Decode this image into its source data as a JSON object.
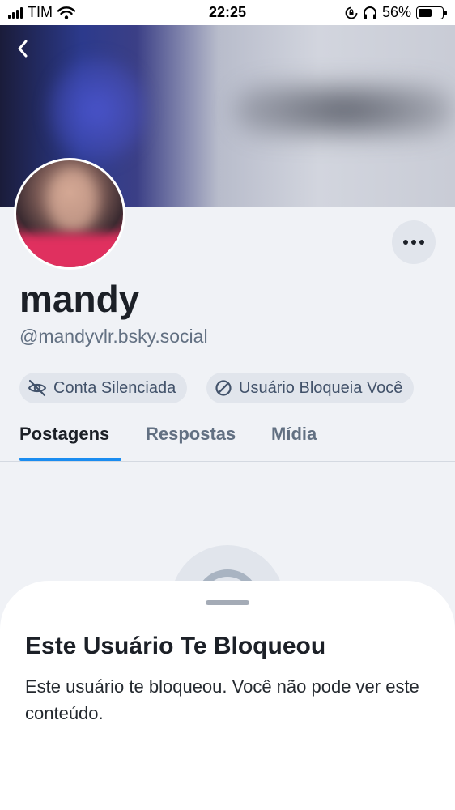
{
  "status_bar": {
    "carrier": "TIM",
    "time": "22:25",
    "battery_percent": "56%",
    "battery_level": 0.56,
    "icons": [
      "signal-icon",
      "wifi-icon",
      "orientation-lock-icon",
      "headphones-icon",
      "battery-icon"
    ]
  },
  "header": {
    "back_icon": "chevron-left-icon"
  },
  "profile": {
    "display_name": "mandy",
    "handle": "@mandyvlr.bsky.social",
    "more_icon": "ellipsis-icon"
  },
  "labels": [
    {
      "icon": "eye-slash-icon",
      "text": "Conta Silenciada"
    },
    {
      "icon": "ban-icon",
      "text": "Usuário Bloqueia Você"
    }
  ],
  "tabs": [
    {
      "label": "Postagens",
      "active": true
    },
    {
      "label": "Respostas",
      "active": false
    },
    {
      "label": "Mídia",
      "active": false
    }
  ],
  "sheet": {
    "title": "Este Usuário Te Bloqueou",
    "body": "Este usuário te bloqueou. Você não pode ver este conteúdo."
  },
  "colors": {
    "accent": "#1a8cf0",
    "background": "#f0f2f6",
    "pill_background": "#e1e5ec",
    "muted_text": "#627082"
  }
}
